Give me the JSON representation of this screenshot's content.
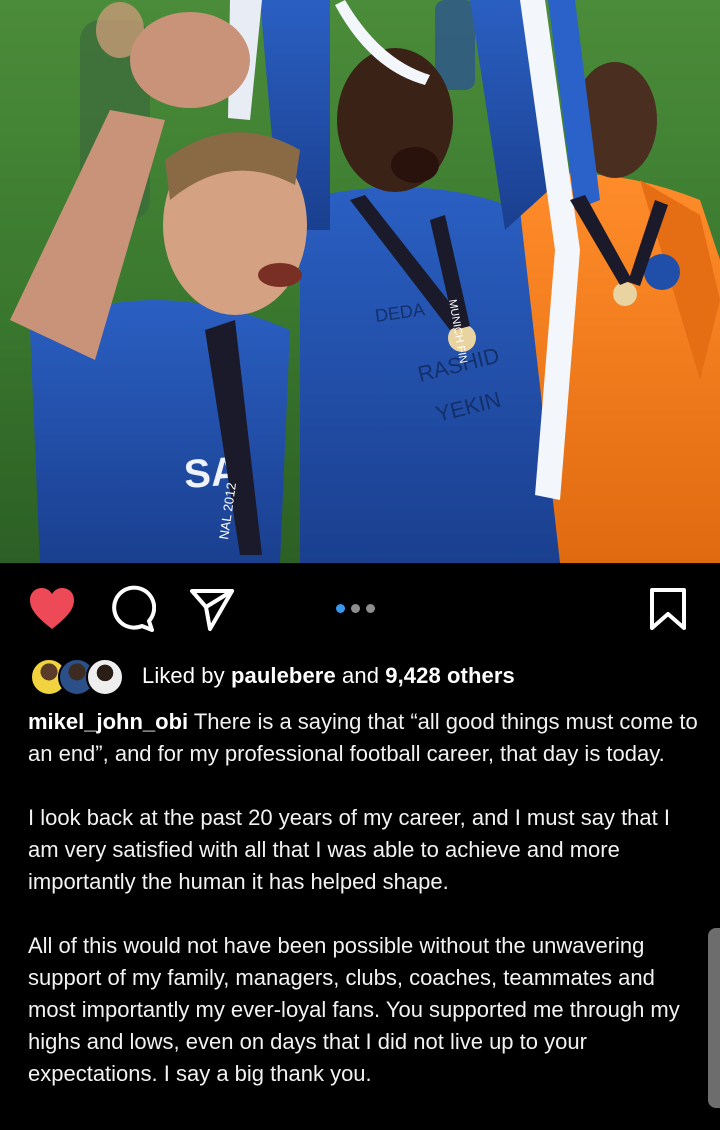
{
  "post": {
    "photo_alt": "Chelsea players celebrating with medals",
    "shirt_texts": [
      "DEDA",
      "RASHID",
      "YEKIN"
    ],
    "lanyard_texts": [
      "MUNICH FINAL",
      "MUNICH FINAL 2012",
      "MUNICH FINAL",
      "NAL 2012"
    ],
    "sponsor_text": "SA"
  },
  "actions": {
    "like_icon": "heart-filled-icon",
    "comment_icon": "comment-icon",
    "share_icon": "paper-plane-icon",
    "save_icon": "bookmark-icon",
    "carousel_total": 3,
    "carousel_active": 1
  },
  "likes": {
    "prefix": "Liked by ",
    "user": "paulebere",
    "middle": " and ",
    "count": "9,428 others"
  },
  "caption": {
    "username": "mikel_john_obi",
    "para1": " There is a saying that “all good things must come to an end”, and for my professional football career, that day is today.",
    "para2": " I look back at the past 20 years of my career, and I must say that I am very satisfied with all that I was able to achieve and more importantly the human it has helped shape.",
    "para3": "All of this would not have been possible without the unwavering support of my family, managers, clubs, coaches, teammates and most importantly my ever-loyal fans. You supported me through my highs and lows, even on days that I did not live up to your expectations. I say a big thank you."
  },
  "colors": {
    "like_red": "#ed4956",
    "dot_active": "#3897f0",
    "chelsea_blue": "#1f4fa8",
    "keeper_orange": "#f27a1a"
  }
}
